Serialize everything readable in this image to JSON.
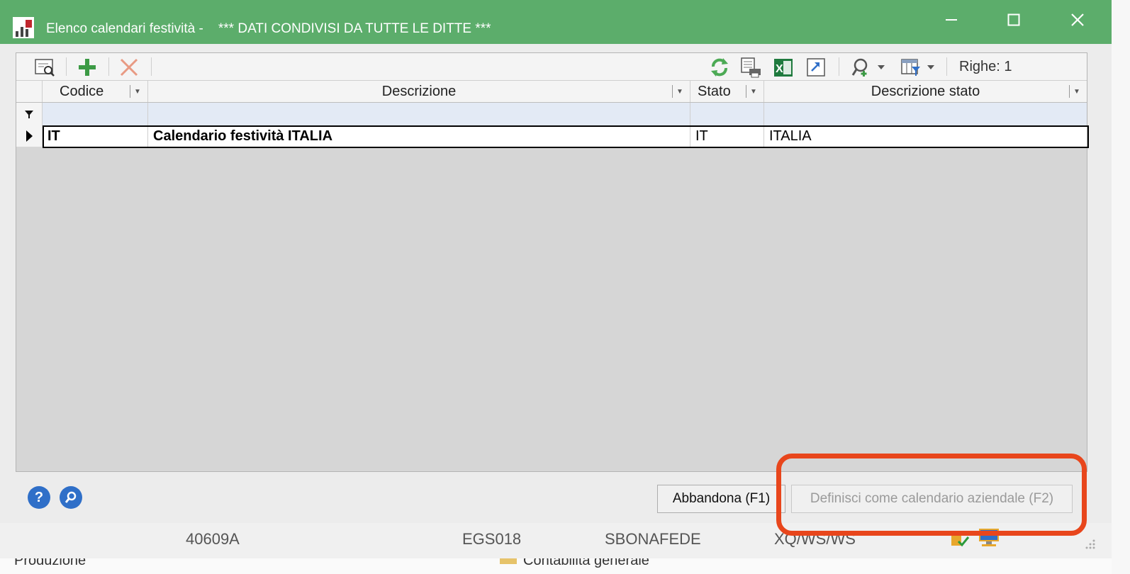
{
  "window": {
    "title": "Elenco calendari festività -    *** DATI CONDIVISI DA TUTTE LE DITTE ***",
    "titlebar_color": "#5cad6b"
  },
  "toolbar": {
    "rows_label": "Righe: 1",
    "icons": [
      "preview-icon",
      "add-icon",
      "delete-icon",
      "refresh-icon",
      "print-icon",
      "excel-icon",
      "export-icon",
      "search-icon",
      "columns-icon"
    ]
  },
  "grid": {
    "columns": [
      {
        "label": "Codice"
      },
      {
        "label": "Descrizione"
      },
      {
        "label": "Stato"
      },
      {
        "label": "Descrizione stato"
      }
    ],
    "rows": [
      {
        "codice": "IT",
        "descrizione": "Calendario festività ITALIA",
        "stato": "IT",
        "descrizione_stato": "ITALIA"
      }
    ]
  },
  "buttons": {
    "abbandona": "Abbandona (F1)",
    "definisci": "Definisci come calendario aziendale (F2)"
  },
  "statusbar": {
    "version": "40609A",
    "code": "EGS018",
    "user": "SBONAFEDE",
    "path": "XQ/WS/WS"
  },
  "background_strip": {
    "left_text": "Produzione",
    "right_text": "Contabilità generale"
  },
  "colors": {
    "highlight": "#e8461c",
    "filter_row": "#e3eaf5",
    "grid_bg": "#d6d6d6"
  }
}
